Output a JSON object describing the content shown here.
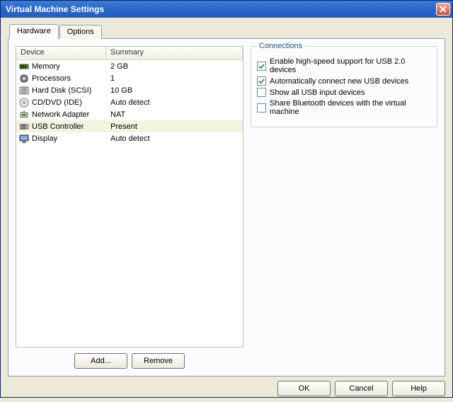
{
  "window": {
    "title": "Virtual Machine Settings"
  },
  "tabs": {
    "hardware": "Hardware",
    "options": "Options"
  },
  "columns": {
    "device": "Device",
    "summary": "Summary"
  },
  "devices": [
    {
      "name": "Memory",
      "summary": "2 GB",
      "icon": "memory"
    },
    {
      "name": "Processors",
      "summary": "1",
      "icon": "cpu"
    },
    {
      "name": "Hard Disk (SCSI)",
      "summary": "10 GB",
      "icon": "disk"
    },
    {
      "name": "CD/DVD (IDE)",
      "summary": "Auto detect",
      "icon": "cd"
    },
    {
      "name": "Network Adapter",
      "summary": "NAT",
      "icon": "net"
    },
    {
      "name": "USB Controller",
      "summary": "Present",
      "icon": "usb"
    },
    {
      "name": "Display",
      "summary": "Auto detect",
      "icon": "display"
    }
  ],
  "selected_index": 5,
  "buttons": {
    "add": "Add...",
    "remove": "Remove",
    "ok": "OK",
    "cancel": "Cancel",
    "help": "Help"
  },
  "group": {
    "title": "Connections",
    "options": [
      {
        "label": "Enable high-speed support for USB 2.0 devices",
        "checked": true
      },
      {
        "label": "Automatically connect new USB devices",
        "checked": true
      },
      {
        "label": "Show all USB input devices",
        "checked": false
      },
      {
        "label": "Share Bluetooth devices with the virtual machine",
        "checked": false
      }
    ]
  }
}
